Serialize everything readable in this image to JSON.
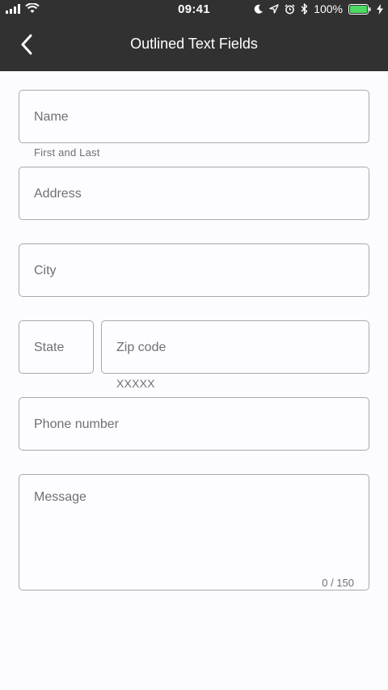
{
  "status_bar": {
    "time": "09:41",
    "battery_percent": "100%",
    "icons": [
      "signal-icon",
      "wifi-icon",
      "moon-icon",
      "location-icon",
      "alarm-icon",
      "bluetooth-icon",
      "battery-icon",
      "charging-icon"
    ]
  },
  "header": {
    "title": "Outlined Text Fields",
    "back_icon": "chevron-left-icon"
  },
  "form": {
    "name": {
      "label": "Name",
      "helper": "First and Last"
    },
    "address": {
      "label": "Address"
    },
    "city": {
      "label": "City"
    },
    "state": {
      "label": "State"
    },
    "zip": {
      "label": "Zip code",
      "helper": "XXXXX"
    },
    "phone": {
      "label": "Phone number"
    },
    "message": {
      "label": "Message",
      "counter": "0 / 150"
    }
  },
  "colors": {
    "header_bg": "#313131",
    "page_bg": "#fcfbfe",
    "outline": "#a9a9ad",
    "label_text": "#6f6f75",
    "battery_green": "#4cd964"
  }
}
